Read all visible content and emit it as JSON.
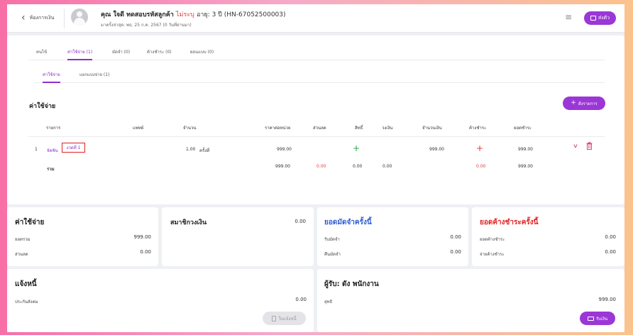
{
  "header": {
    "back_label": "ห้องการเงิน",
    "patient_name": "คุณ ใจดี ทดสอบรหัสลูกค้า",
    "gender": "ไม่ระบุ",
    "age_hn": "อายุ: 3 ปี (HN-67052500003)",
    "visit_info": "มาครั้งล่าสุด: พฤ. 25 ก.ค. 2567 (0 วันที่ผ่านมา)",
    "send_label": "ส่งตัว"
  },
  "tabs_primary": [
    {
      "label": "คนไข้",
      "active": false
    },
    {
      "label": "ค่าใช้จ่าย (1)",
      "active": true
    },
    {
      "label": "มัดจำ (0)",
      "active": false
    },
    {
      "label": "ค้างชำระ (0)",
      "active": false
    },
    {
      "label": "ผ่อนแบบ (0)",
      "active": false
    }
  ],
  "tabs_secondary": [
    {
      "label": "ค่าใช้จ่าย",
      "active": true
    },
    {
      "label": "แยกแบ่งจ่าย (1)",
      "active": false
    }
  ],
  "section": {
    "title": "ค่าใช้จ่าย",
    "add_button": "สั่งรายการ"
  },
  "table": {
    "columns": [
      "รายการ",
      "แพทย์",
      "จำนวน",
      "ราคาต่อหน่วย",
      "ส่วนลด",
      "สิทธิ์",
      "วงเงิน",
      "จำนวนเงิน",
      "ค้างชำระ",
      "ยอดชำระ"
    ],
    "row": {
      "index": "1",
      "item": "จัดฟัน",
      "tag": "งวดที่ 1",
      "qty": "1.00",
      "unit": "ครั้งที่",
      "unit_price": "999.00",
      "amount": "999.00",
      "paid": "999.00"
    },
    "total": {
      "label": "รวม",
      "unit_price": "999.00",
      "discount": "0.00",
      "rights": "0.00",
      "limit": "0.00",
      "outstanding": "0.00",
      "paid": "999.00"
    }
  },
  "summary_cost": {
    "title": "ค่าใช้จ่าย",
    "total_label": "ยอดรวม",
    "total_value": "999.00",
    "discount_label": "ส่วนลด",
    "discount_value": "0.00"
  },
  "summary_wallet": {
    "title": "สมาชิกวงเงิน",
    "value": "0.00"
  },
  "summary_deposit": {
    "title": "ยอดมัดจำครั้งนี้",
    "title_color": "#2f5fd0",
    "receive_label": "รับมัดจำ",
    "receive_value": "0.00",
    "refund_label": "คืนมัดจำ",
    "refund_value": "0.00"
  },
  "summary_outstanding": {
    "title": "ยอดค้างชำระครั้งนี้",
    "title_color": "#e02424",
    "owed_label": "ยอดค้างชำระ",
    "owed_value": "0.00",
    "pay_label": "จ่ายค้างชำระ",
    "pay_value": "0.00"
  },
  "debt": {
    "title": "แจ้งหนี้",
    "insurance_label": "ประกันสังคม",
    "insurance_value": "0.00",
    "receipt_button": "ใบแจ้งหนี้"
  },
  "receiver": {
    "title": "ผู้รับ: ดัง พนักงาน",
    "net_label": "สุทธิ",
    "net_value": "999.00",
    "pay_button": "รับเงิน"
  },
  "colors": {
    "accent": "#9b37d6",
    "red": "#e23b3b",
    "green": "#27a84a"
  }
}
